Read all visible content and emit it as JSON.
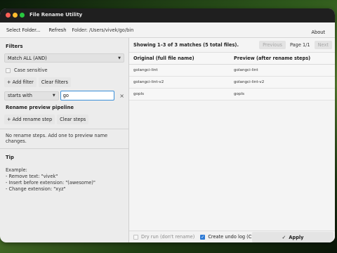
{
  "window": {
    "title": "File Rename Utility"
  },
  "toolbar": {
    "select_folder": "Select Folder...",
    "refresh": "Refresh",
    "folder_label": "Folder: /Users/vivek/go/bin",
    "about": "About"
  },
  "filters": {
    "title": "Filters",
    "match_mode": "Match ALL (AND)",
    "case_sensitive": "Case sensitive",
    "add_filter": "+ Add filter",
    "clear_filters": "Clear filters",
    "filter_type": "starts with",
    "filter_value": "go"
  },
  "pipeline": {
    "title": "Rename preview pipeline",
    "add_step": "+ Add rename step",
    "clear_steps": "Clear steps",
    "empty_text": "No rename steps. Add one to preview name changes."
  },
  "tip": {
    "title": "Tip",
    "lines": [
      "Example:",
      "- Remove text: \"vivek\"",
      "- Insert before extension: \"(awesome)\"",
      "- Change extension: \"xyz\""
    ]
  },
  "results": {
    "status": "Showing 1–3 of 3 matches (5 total files).",
    "previous": "Previous",
    "page": "Page 1/1",
    "next": "Next",
    "col_original": "Original (full file name)",
    "col_preview": "Preview (after rename steps)",
    "rows": [
      {
        "original": "golangci-lint",
        "preview": "golangci-lint"
      },
      {
        "original": "golangci-lint-v2",
        "preview": "golangci-lint-v2"
      },
      {
        "original": "gopls",
        "preview": "gopls"
      }
    ]
  },
  "footer": {
    "dry_run": "Dry run (don't rename)",
    "undo_log": "Create undo log (CSV)",
    "apply": "Apply"
  },
  "colors": {
    "accent": "#2f7bd6",
    "titlebar": "#1f1f1f"
  }
}
